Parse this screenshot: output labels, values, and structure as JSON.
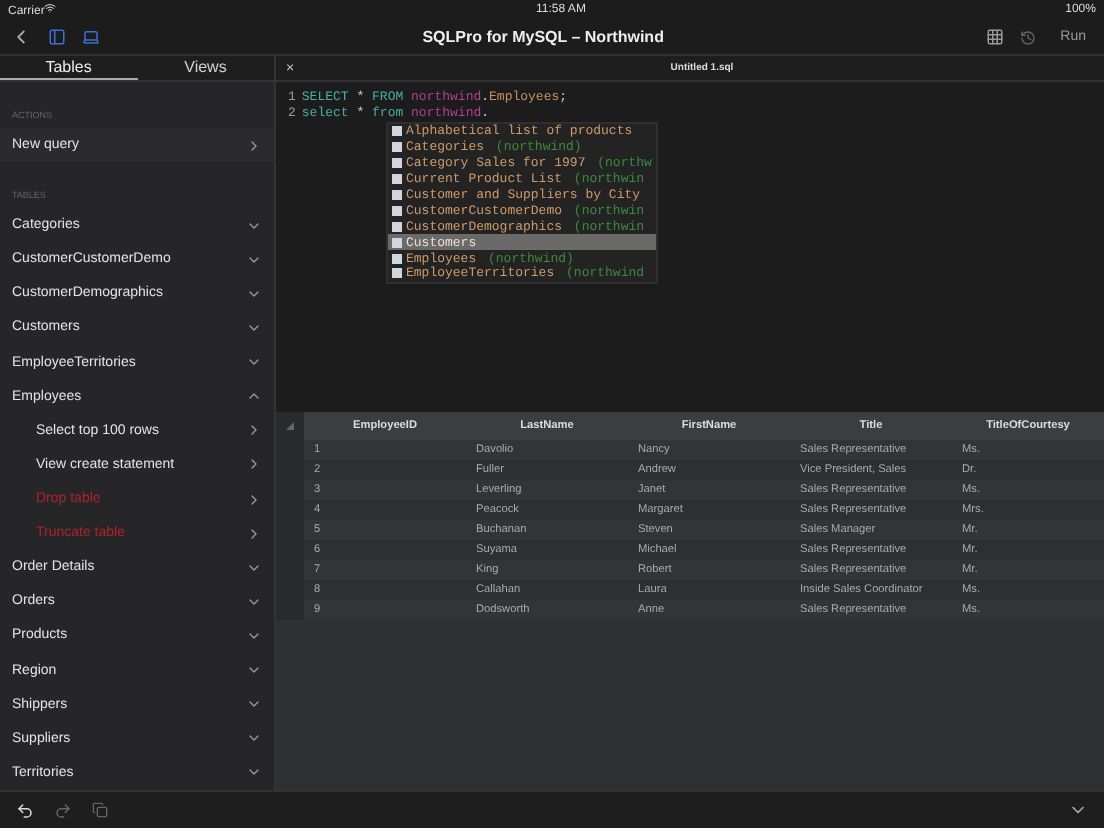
{
  "status_bar": {
    "carrier": "Carrier",
    "time": "11:58 AM",
    "battery": "100%"
  },
  "nav_bar": {
    "title": "SQLPro for MySQL – Northwind",
    "run": "Run"
  },
  "sidebar": {
    "tabs": [
      {
        "label": "Tables",
        "selected": true
      },
      {
        "label": "Views",
        "selected": false
      }
    ],
    "sections": [
      {
        "header": "ACTIONS",
        "items": [
          {
            "label": "New query",
            "kind": "action",
            "expanded": false
          }
        ]
      },
      {
        "header": "TABLES",
        "items": [
          {
            "label": "Categories",
            "kind": "table",
            "expanded": false
          },
          {
            "label": "CustomerCustomerDemo",
            "kind": "table",
            "expanded": false
          },
          {
            "label": "CustomerDemographics",
            "kind": "table",
            "expanded": false
          },
          {
            "label": "Customers",
            "kind": "table",
            "expanded": false
          },
          {
            "label": "EmployeeTerritories",
            "kind": "table",
            "expanded": false
          },
          {
            "label": "Employees",
            "kind": "table",
            "expanded": true,
            "children": [
              {
                "label": "Select top 100 rows",
                "kind": "action"
              },
              {
                "label": "View create statement",
                "kind": "action"
              },
              {
                "label": "Drop table",
                "kind": "danger"
              },
              {
                "label": "Truncate table",
                "kind": "danger"
              }
            ]
          },
          {
            "label": "Order Details",
            "kind": "table",
            "expanded": false
          },
          {
            "label": "Orders",
            "kind": "table",
            "expanded": false
          },
          {
            "label": "Products",
            "kind": "table",
            "expanded": false
          },
          {
            "label": "Region",
            "kind": "table",
            "expanded": false
          },
          {
            "label": "Shippers",
            "kind": "table",
            "expanded": false
          },
          {
            "label": "Suppliers",
            "kind": "table",
            "expanded": false
          },
          {
            "label": "Territories",
            "kind": "table",
            "expanded": false
          }
        ]
      }
    ]
  },
  "editor": {
    "tab": "Untitled 1.sql",
    "close": "×",
    "lines": [
      {
        "number": "1",
        "tokens": [
          {
            "kind": "keyword",
            "text": "SELECT"
          },
          {
            "kind": "plain",
            "text": " * "
          },
          {
            "kind": "keyword",
            "text": "FROM"
          },
          {
            "kind": "schema",
            "text": "northwind"
          },
          {
            "kind": "plain",
            "text": "."
          },
          {
            "kind": "table",
            "text": "Employees"
          },
          {
            "kind": "plain",
            "text": ";"
          }
        ]
      },
      {
        "number": "2",
        "tokens": [
          {
            "kind": "keyword",
            "text": "select"
          },
          {
            "kind": "plain",
            "text": " * "
          },
          {
            "kind": "keyword",
            "text": "from"
          },
          {
            "kind": "schema",
            "text": "northwind"
          },
          {
            "kind": "plain",
            "text": "."
          }
        ]
      }
    ],
    "completions": [
      {
        "name": "Alphabetical list of products",
        "selected": false
      },
      {
        "name": "Categories",
        "schema": "(northwind)",
        "selected": false
      },
      {
        "name": "Category Sales for 1997",
        "schema": "(northw",
        "selected": false
      },
      {
        "name": "Current Product List",
        "schema": "(northwin",
        "selected": false
      },
      {
        "name": "Customer and Suppliers by City",
        "selected": false
      },
      {
        "name": "CustomerCustomerDemo",
        "schema": "(northwin",
        "selected": false
      },
      {
        "name": "CustomerDemographics",
        "schema": "(northwin",
        "selected": false
      },
      {
        "name": "Customers",
        "selected": true
      },
      {
        "name": "Employees",
        "schema": "(northwind)",
        "selected": false
      },
      {
        "name": "EmployeeTerritories",
        "schema": "(northwind",
        "selected": false
      }
    ]
  },
  "results": {
    "columns": [
      "EmployeeID",
      "LastName",
      "FirstName",
      "Title",
      "TitleOfCourtesy"
    ],
    "rows": [
      [
        "1",
        "Davolio",
        "Nancy",
        "Sales Representative",
        "Ms."
      ],
      [
        "2",
        "Fuller",
        "Andrew",
        "Vice President, Sales",
        "Dr."
      ],
      [
        "3",
        "Leverling",
        "Janet",
        "Sales Representative",
        "Ms."
      ],
      [
        "4",
        "Peacock",
        "Margaret",
        "Sales Representative",
        "Mrs."
      ],
      [
        "5",
        "Buchanan",
        "Steven",
        "Sales Manager",
        "Mr."
      ],
      [
        "6",
        "Suyama",
        "Michael",
        "Sales Representative",
        "Mr."
      ],
      [
        "7",
        "King",
        "Robert",
        "Sales Representative",
        "Mr."
      ],
      [
        "8",
        "Callahan",
        "Laura",
        "Inside Sales Coordinator",
        "Ms."
      ],
      [
        "9",
        "Dodsworth",
        "Anne",
        "Sales Representative",
        "Ms."
      ]
    ]
  }
}
